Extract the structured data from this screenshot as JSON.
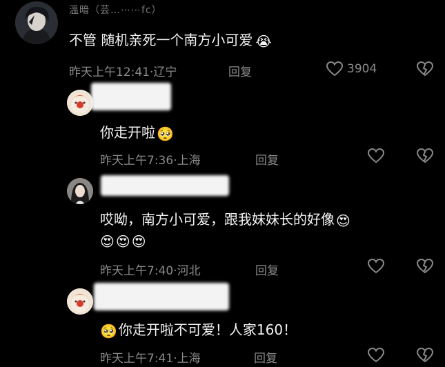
{
  "comments": [
    {
      "username": "溫暗（芸…⋯⋯fc）",
      "text": "不管 随机亲死一个南方小可爱",
      "emoji": "😭",
      "time": "昨天上午12:41",
      "location": "辽宁",
      "reply_label": "回复",
      "likes": "3904"
    },
    {
      "text": "你走开啦",
      "emoji": "🥺",
      "time": "昨天上午7:36",
      "location": "上海",
      "reply_label": "回复"
    },
    {
      "text": "哎呦，南方小可爱，跟我妹妹长的好像",
      "emoji": "😍",
      "text2": "😍😍😍",
      "time": "昨天上午7:40",
      "location": "河北",
      "reply_label": "回复"
    },
    {
      "emoji": "🥺",
      "text": "你走开啦不可爱！人家160！",
      "time": "昨天上午7:41",
      "location": "上海",
      "reply_label": "回复"
    }
  ],
  "icons": {
    "like": "heart-outline-icon",
    "dislike": "broken-heart-icon"
  },
  "colors": {
    "background": "#000000",
    "text": "#f4f4f4",
    "meta": "#8a8a8a"
  }
}
